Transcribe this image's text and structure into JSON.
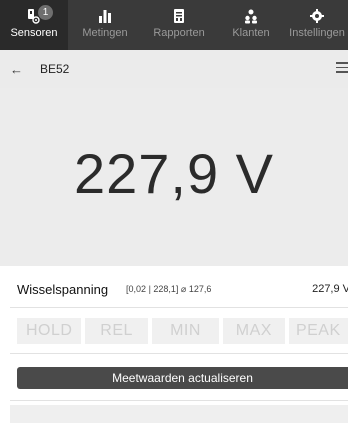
{
  "nav": {
    "items": [
      {
        "label": "Sensoren",
        "icon": "sensor-icon",
        "active": true,
        "badge": "1"
      },
      {
        "label": "Metingen",
        "icon": "bar-chart-icon",
        "active": false
      },
      {
        "label": "Rapporten",
        "icon": "report-icon",
        "active": false
      },
      {
        "label": "Klanten",
        "icon": "users-icon",
        "active": false
      },
      {
        "label": "Instellingen",
        "icon": "gear-icon",
        "active": false
      }
    ]
  },
  "header": {
    "back_icon": "←",
    "device_name": "BE52",
    "menu_icon": "hamburger-menu-icon"
  },
  "reading": {
    "value": "227,9 V"
  },
  "measurement": {
    "name": "Wisselspanning",
    "range": "[0,02 | 228,1]  ⌀ 127,6",
    "value": "227,9 V"
  },
  "modes": [
    "HOLD",
    "REL",
    "MIN",
    "MAX",
    "PEAK"
  ],
  "action_label": "Meetwaarden actualiseren",
  "colors": {
    "nav_bg": "#3a3a3a",
    "nav_active_bg": "#2a2a2a",
    "header_bg": "#ebebeb",
    "reading_bg": "#ececec",
    "action_bg": "#4a4a4a"
  }
}
